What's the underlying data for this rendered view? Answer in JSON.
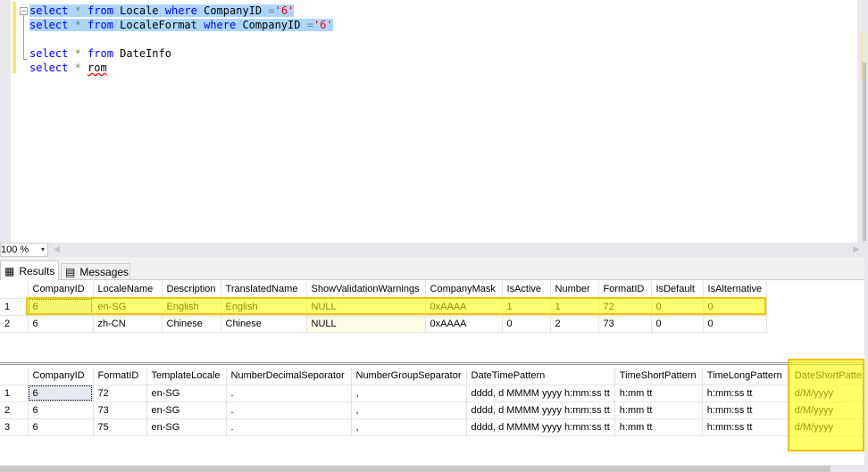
{
  "editor": {
    "lines": [
      {
        "kind": "selected",
        "tokens": [
          [
            "kw",
            "select"
          ],
          [
            "op",
            " * "
          ],
          [
            "kw",
            "from"
          ],
          [
            "id",
            " Locale "
          ],
          [
            "kw",
            "where"
          ],
          [
            "id",
            " CompanyID "
          ],
          [
            "op",
            "="
          ],
          [
            "str",
            "'6'"
          ]
        ]
      },
      {
        "kind": "selected",
        "tokens": [
          [
            "kw",
            "select"
          ],
          [
            "op",
            " * "
          ],
          [
            "kw",
            "from"
          ],
          [
            "id",
            " LocaleFormat "
          ],
          [
            "kw",
            "where"
          ],
          [
            "id",
            " CompanyID "
          ],
          [
            "op",
            "="
          ],
          [
            "str",
            "'6'"
          ]
        ]
      },
      {
        "kind": "blank",
        "tokens": []
      },
      {
        "kind": "normal",
        "tokens": [
          [
            "kw",
            "select"
          ],
          [
            "op",
            " * "
          ],
          [
            "kw",
            "from"
          ],
          [
            "id",
            " DateInfo"
          ]
        ]
      },
      {
        "kind": "normal",
        "tokens": [
          [
            "kw",
            "select"
          ],
          [
            "op",
            " * "
          ],
          [
            "err",
            "rom"
          ]
        ]
      }
    ],
    "fold_symbol": "−"
  },
  "zoom": {
    "value": "100 %",
    "arrow": "▾"
  },
  "tabs": {
    "results": {
      "label": "Results",
      "icon": "▦"
    },
    "messages": {
      "label": "Messages",
      "icon": "▤"
    }
  },
  "grid1": {
    "columns": [
      "CompanyID",
      "LocaleName",
      "Description",
      "TranslatedName",
      "ShowValidationWarnings",
      "CompanyMask",
      "IsActive",
      "Number",
      "FormatID",
      "IsDefault",
      "IsAlternative"
    ],
    "rows": [
      {
        "num": "1",
        "cells": [
          "6",
          "en-SG",
          "English",
          "English",
          "NULL",
          "0xAAAA",
          "1",
          "1",
          "72",
          "0",
          "0"
        ]
      },
      {
        "num": "2",
        "cells": [
          "6",
          "zh-CN",
          "Chinese",
          "Chinese",
          "NULL",
          "0xAAAA",
          "0",
          "2",
          "73",
          "0",
          "0"
        ]
      }
    ]
  },
  "grid2": {
    "columns": [
      "CompanyID",
      "FormatID",
      "TemplateLocale",
      "NumberDecimalSeporator",
      "NumberGroupSeparator",
      "DateTimePattern",
      "TimeShortPattern",
      "TimeLongPattern",
      "DateShortPattern"
    ],
    "rows": [
      {
        "num": "1",
        "cells": [
          "6",
          "72",
          "en-SG",
          ".",
          ",",
          "dddd, d MMMM yyyy h:mm:ss tt",
          "h:mm tt",
          "h:mm:ss tt",
          "d/M/yyyy"
        ]
      },
      {
        "num": "2",
        "cells": [
          "6",
          "73",
          "en-SG",
          ".",
          ",",
          "dddd, d MMMM yyyy h:mm:ss tt",
          "h:mm tt",
          "h:mm:ss tt",
          "d/M/yyyy"
        ]
      },
      {
        "num": "3",
        "cells": [
          "6",
          "75",
          "en-SG",
          ".",
          ",",
          "dddd, d MMMM yyyy h:mm:ss tt",
          "h:mm tt",
          "h:mm:ss tt",
          "d/M/yyyy"
        ]
      }
    ]
  },
  "colors": {
    "highlight": "#ffff00",
    "highlight_border": "#f0c400",
    "selection": "#add6ff",
    "keyword": "#0000ff",
    "string": "#ff0000"
  }
}
